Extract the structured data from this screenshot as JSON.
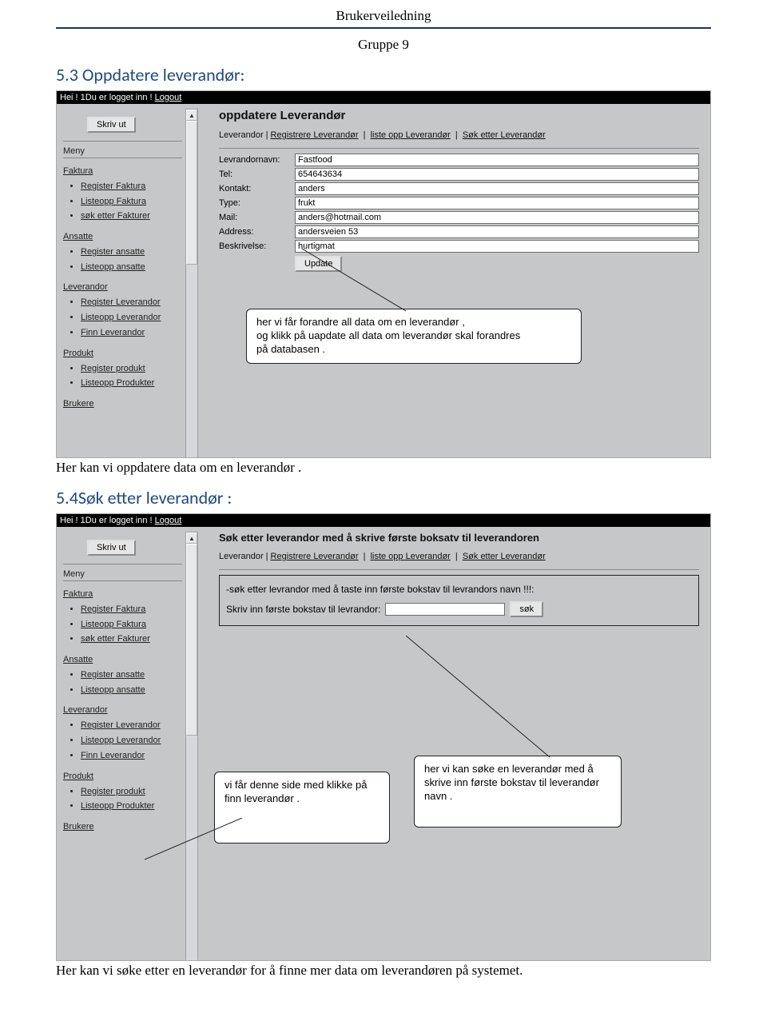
{
  "doc": {
    "title": "Brukerveiledning",
    "group": "Gruppe 9",
    "section_53": "5.3 Oppdatere leverandør:",
    "section_54": "5.4Søk etter leverandør :",
    "caption_53": "Her kan vi oppdatere data  om en leverandør .",
    "caption_54": "Her kan vi søke etter en leverandør for å finne mer data om leverandøren på systemet."
  },
  "topbar": {
    "greeting": "Hei ! 1Du er logget inn ! ",
    "logout": "Logout"
  },
  "sidebar": {
    "print": "Skriv ut",
    "menu": "Meny",
    "sections": {
      "faktura": {
        "label": "Faktura",
        "items": [
          "Register Faktura",
          "Listeopp Faktura",
          "søk etter Fakturer"
        ]
      },
      "ansatte": {
        "label": "Ansatte",
        "items": [
          "Register ansatte",
          "Listeopp ansatte"
        ]
      },
      "leverandor": {
        "label": "Leverandor",
        "items": [
          "Register Leverandor",
          "Listeopp Leverandor",
          "Finn Leverandor"
        ]
      },
      "produkt": {
        "label": "Produkt",
        "items": [
          "Register produkt",
          "Listeopp Produkter"
        ]
      },
      "brukere": {
        "label": "Brukere"
      }
    }
  },
  "ss1": {
    "title": "oppdatere Leverandør",
    "crumbs": {
      "c0": "Leverandor",
      "c1": "Registrere Leverandør",
      "c2": "liste opp Leverandør",
      "c3": "Søk etter Leverandør"
    },
    "sep": "|",
    "fields": {
      "levrandornavn": {
        "label": "Levrandornavn:",
        "value": "Fastfood"
      },
      "tel": {
        "label": "Tel:",
        "value": "654643634"
      },
      "kontakt": {
        "label": "Kontakt:",
        "value": "anders"
      },
      "type": {
        "label": "Type:",
        "value": "frukt"
      },
      "mail": {
        "label": "Mail:",
        "value": "anders@hotmail.com"
      },
      "address": {
        "label": "Address:",
        "value": "andersveien 53"
      },
      "beskrivelse": {
        "label": "Beskrivelse:",
        "value": "hurtigmat"
      }
    },
    "update": "Update",
    "callout": "her  vi får forandre all data om en leverandør ,\nog klikk på uapdate all data om leverandør skal forandres\npå databasen ."
  },
  "ss2": {
    "title": "Søk etter leverandor med å skrive første boksatv til leverandoren",
    "crumbs": {
      "c0": "Leverandor",
      "c1": "Registrere Leverandør",
      "c2": "liste opp Leverandør",
      "c3": "Søk etter Leverandør"
    },
    "sep": "|",
    "search": {
      "hint": "-søk etter levrandor med å taste inn første bokstav til levrandors navn !!!:",
      "label": "Skriv inn første bokstav til levrandor:",
      "btn": "søk"
    },
    "callout_left": "vi får denne side  med klikke på finn leverandør .",
    "callout_right": "her  vi  kan søke en leverandør med å skrive inn første  bokstav til leverandør navn ."
  }
}
